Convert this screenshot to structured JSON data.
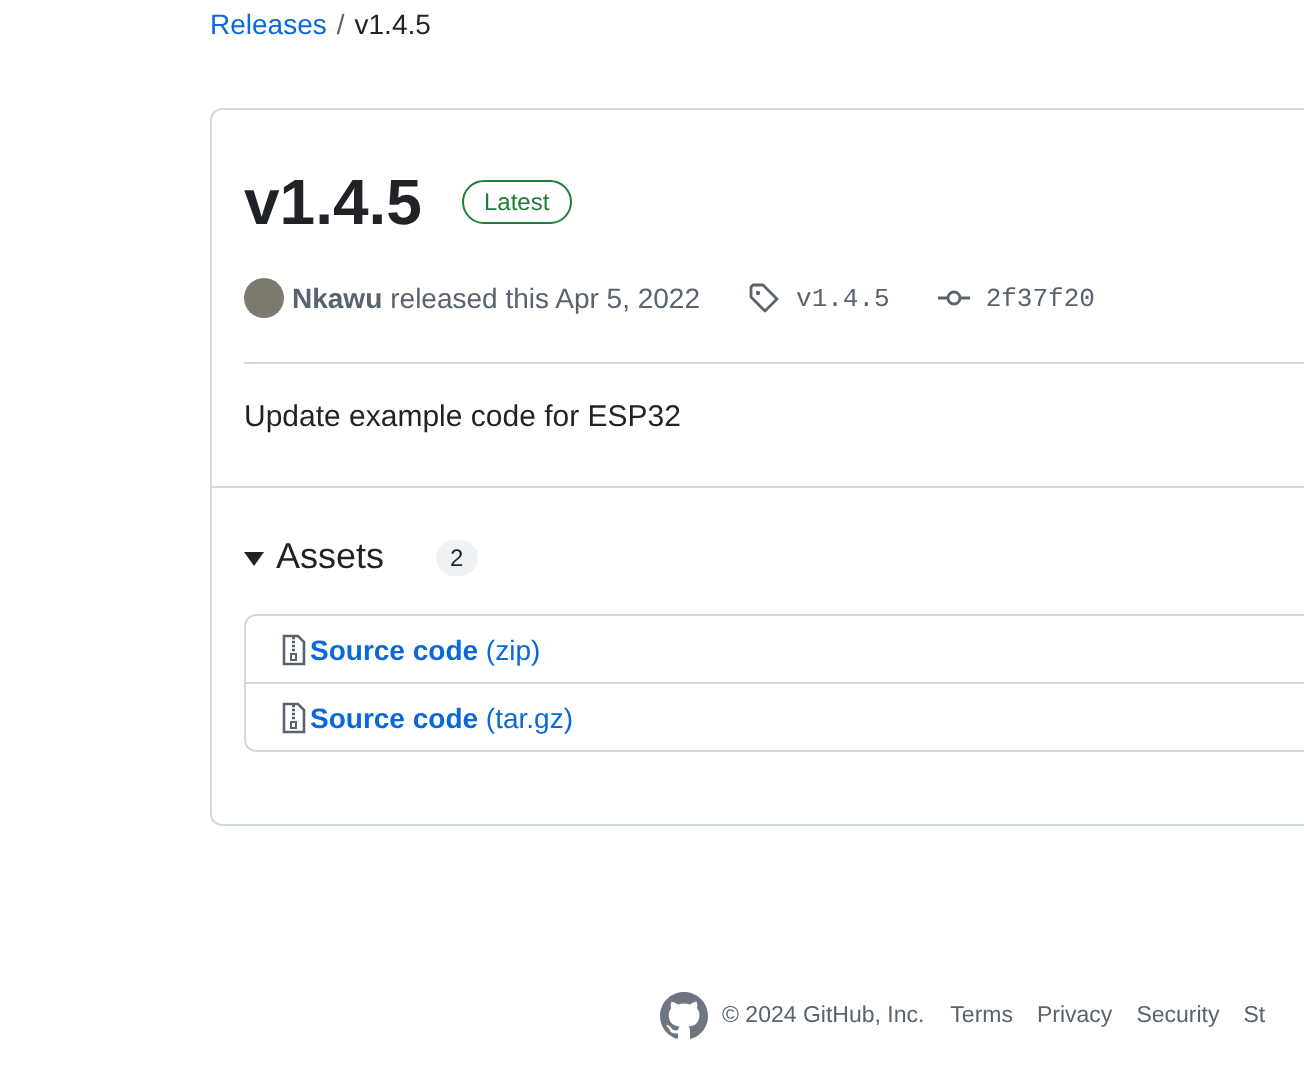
{
  "breadcrumb": {
    "link": "Releases",
    "separator": "/",
    "current": "v1.4.5"
  },
  "release": {
    "title": "v1.4.5",
    "badge": "Latest",
    "author": "Nkawu",
    "released_text": "released this Apr 5, 2022",
    "tag": "v1.4.5",
    "commit": "2f37f20",
    "description": "Update example code for ESP32"
  },
  "assets": {
    "title": "Assets",
    "count": "2",
    "expanded": true,
    "items": [
      {
        "label": "**Source code** (zip)"
      },
      {
        "label": "**Source code** (tar.gz)"
      }
    ]
  },
  "footer": {
    "copyright": "© 2024 GitHub, Inc.",
    "links": [
      "Terms",
      "Privacy",
      "Security",
      "St"
    ]
  }
}
